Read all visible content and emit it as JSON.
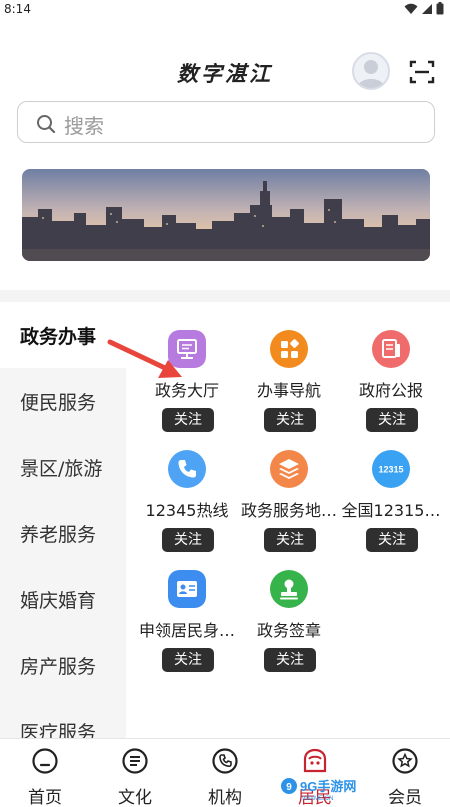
{
  "status_bar": {
    "time": "8:14"
  },
  "header": {
    "title": "数字湛江"
  },
  "search": {
    "placeholder": "搜索"
  },
  "sidebar": {
    "items": [
      {
        "label": "政务办事",
        "active": true
      },
      {
        "label": "便民服务"
      },
      {
        "label": "景区/旅游"
      },
      {
        "label": "养老服务"
      },
      {
        "label": "婚庆婚育"
      },
      {
        "label": "房产服务"
      },
      {
        "label": "医疗服务"
      }
    ]
  },
  "services": {
    "follow_label": "关注",
    "items": [
      {
        "label": "政务大厅",
        "icon": "monitor-icon",
        "color": "#b77be0"
      },
      {
        "label": "办事导航",
        "icon": "grid-icon",
        "color": "#f28a1e"
      },
      {
        "label": "政府公报",
        "icon": "document-icon",
        "color": "#f06b6b"
      },
      {
        "label": "12345热线",
        "icon": "phone-icon",
        "color": "#4ea3f5"
      },
      {
        "label": "政务服务地…",
        "icon": "layers-icon",
        "color": "#f3874a"
      },
      {
        "label": "全国12315…",
        "icon": "12315-icon",
        "icon_text": "12315",
        "color": "#3aa2f3"
      },
      {
        "label": "申领居民身…",
        "icon": "id-card-icon",
        "color": "#3d8cf0"
      },
      {
        "label": "政务签章",
        "icon": "stamp-icon",
        "color": "#36b34a"
      }
    ]
  },
  "tabbar": {
    "items": [
      {
        "label": "首页",
        "icon": "home-icon"
      },
      {
        "label": "文化",
        "icon": "culture-icon"
      },
      {
        "label": "机构",
        "icon": "phone-ring-icon"
      },
      {
        "label": "居民",
        "icon": "resident-icon",
        "active": true
      },
      {
        "label": "会员",
        "icon": "member-icon"
      }
    ]
  },
  "colors": {
    "accent": "#c8242f",
    "follow_bg": "#2f2f2f",
    "sidebar_bg": "#f5f5f5"
  },
  "watermark": {
    "text": "9G手游网",
    "sub": "9GAME.CN"
  }
}
